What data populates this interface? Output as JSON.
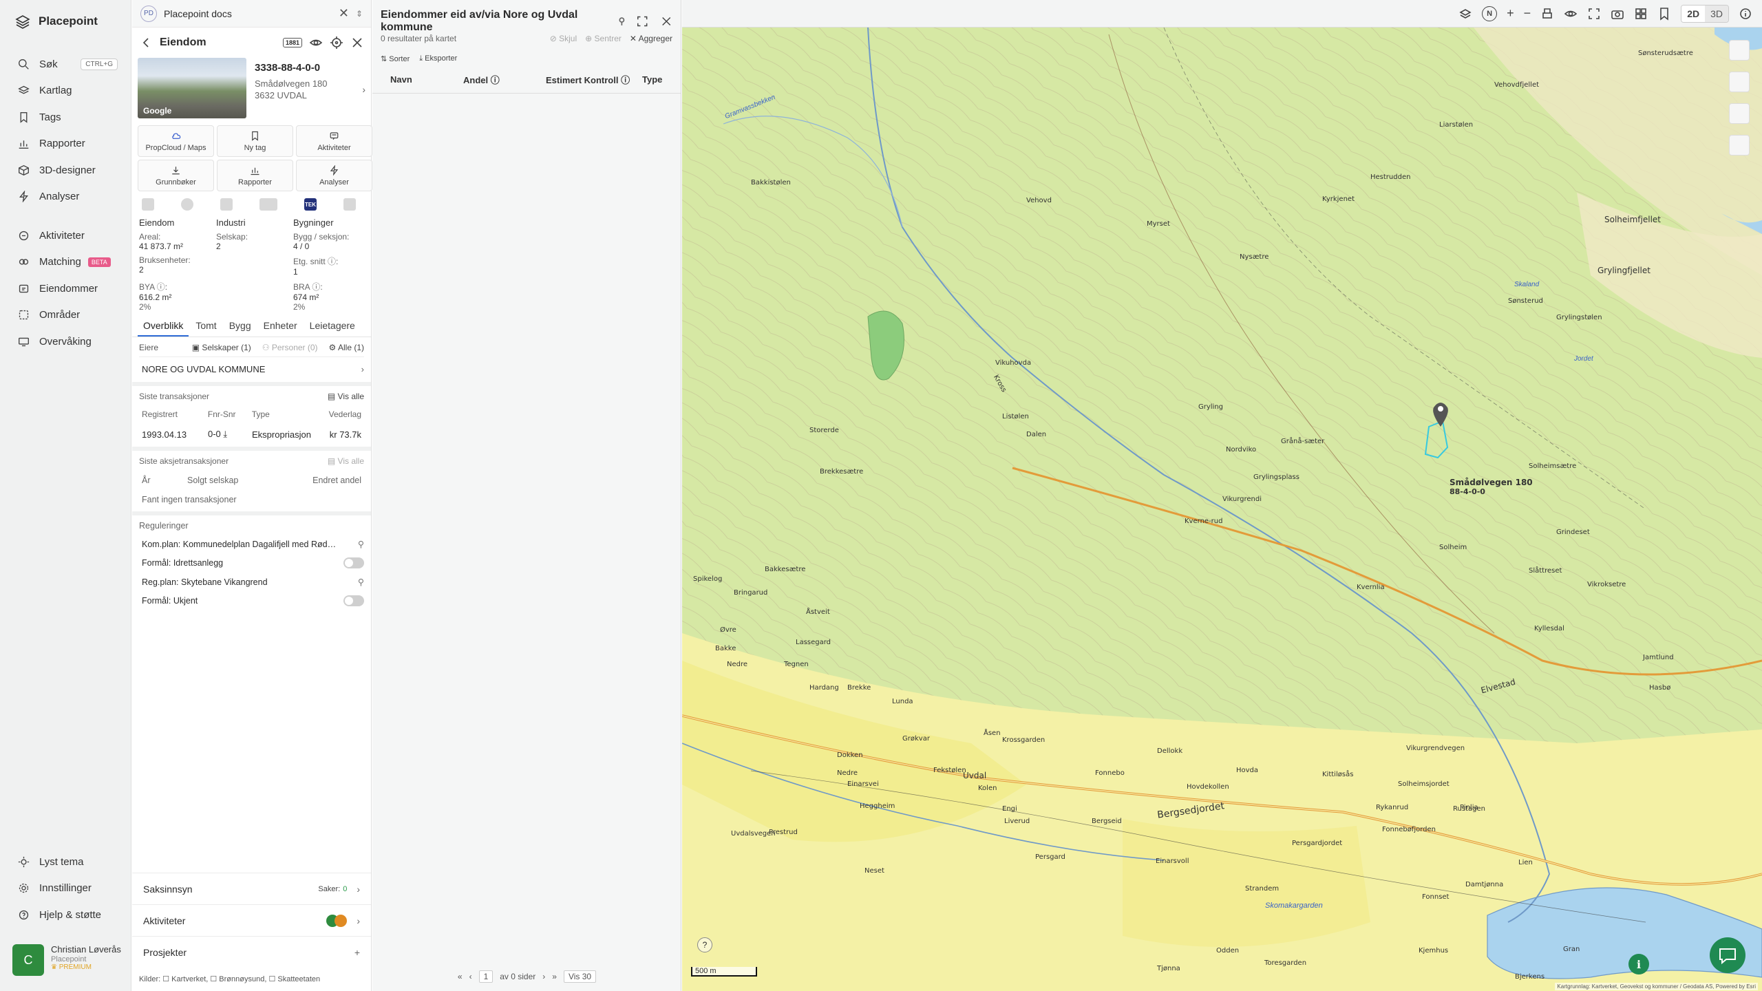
{
  "nav": {
    "brand": "Placepoint",
    "items": [
      {
        "label": "Søk",
        "icon": "search-icon",
        "shortcut": "CTRL+G"
      },
      {
        "label": "Kartlag",
        "icon": "layers-icon"
      },
      {
        "label": "Tags",
        "icon": "bookmark-icon"
      },
      {
        "label": "Rapporter",
        "icon": "chart-icon"
      },
      {
        "label": "3D-designer",
        "icon": "cube-icon"
      },
      {
        "label": "Analyser",
        "icon": "bolt-icon"
      }
    ],
    "items2": [
      {
        "label": "Aktiviteter",
        "icon": "activity-icon"
      },
      {
        "label": "Matching",
        "icon": "matching-icon",
        "badge": "BETA"
      },
      {
        "label": "Eiendommer",
        "icon": "property-icon"
      },
      {
        "label": "Områder",
        "icon": "area-icon"
      },
      {
        "label": "Overvåking",
        "icon": "monitor-icon"
      }
    ],
    "bottom": [
      {
        "label": "Lyst tema",
        "icon": "sun-icon"
      },
      {
        "label": "Innstillinger",
        "icon": "gear-icon"
      },
      {
        "label": "Hjelp & støtte",
        "icon": "help-icon"
      }
    ],
    "user": {
      "initial": "C",
      "name": "Christian Løverås",
      "org": "Placepoint",
      "plan": "PREMIUM"
    }
  },
  "docs": {
    "badge": "PD",
    "title": "Placepoint docs"
  },
  "property": {
    "header": "Eiendom",
    "id": "3338-88-4-0-0",
    "street": "Smådølvegen 180",
    "postal": "3632 UVDAL",
    "thumb_label": "Google",
    "actions": [
      {
        "label": "PropCloud / Maps",
        "icon": "cloud-icon"
      },
      {
        "label": "Ny tag",
        "icon": "bookmark-icon"
      },
      {
        "label": "Aktiviteter",
        "icon": "message-icon"
      },
      {
        "label": "Grunnbøker",
        "icon": "download-icon"
      },
      {
        "label": "Rapporter",
        "icon": "chart-icon"
      },
      {
        "label": "Analyser",
        "icon": "bolt-icon"
      }
    ],
    "tek_label": "TEK",
    "stats": {
      "c1": "Eiendom",
      "c2": "Industri",
      "c3": "Bygninger",
      "areal_l": "Areal:",
      "areal_v": "41 873.7 m²",
      "selskap_l": "Selskap:",
      "selskap_v": "2",
      "bygg_l": "Bygg / seksjon:",
      "bygg_v": "4 / 0",
      "bruks_l": "Bruksenheter:",
      "bruks_v": "2",
      "etg_l": "Etg. snitt ⓘ:",
      "etg_v": "1",
      "bya_l": "BYA ⓘ:",
      "bya_v": "616.2 m²",
      "bya_p": "2%",
      "bra_l": "BRA ⓘ:",
      "bra_v": "674 m²",
      "bra_p": "2%"
    },
    "tabs": [
      "Overblikk",
      "Tomt",
      "Bygg",
      "Enheter",
      "Leietagere"
    ],
    "owners": {
      "label": "Eiere",
      "f1": "Selskaper (1)",
      "f2": "Personer (0)",
      "f3": "Alle (1)",
      "name": "NORE OG UVDAL KOMMUNE"
    },
    "trans": {
      "title": "Siste transaksjoner",
      "viewall": "Vis alle",
      "headers": [
        "Registrert",
        "Fnr-Snr",
        "Type",
        "Vederlag"
      ],
      "row": [
        "1993.04.13",
        "0-0 ⤓",
        "Ekspropriasjon",
        "kr 73.7k"
      ]
    },
    "shares": {
      "title": "Siste aksjetransaksjoner",
      "viewall": "Vis alle",
      "headers": [
        "År",
        "Solgt selskap",
        "Endret andel"
      ],
      "empty": "Fant ingen transaksjoner"
    },
    "reg": {
      "title": "Reguleringer",
      "items": [
        {
          "text": "Kom.plan: Kommunedelplan Dagalifjell med Rød…",
          "link": true
        },
        {
          "text": "Formål: Idrettsanlegg",
          "toggle": true
        },
        {
          "text": "Reg.plan: Skytebane Vikangrend",
          "link": true
        },
        {
          "text": "Formål: Ukjent",
          "toggle": true
        }
      ]
    },
    "acc": {
      "s1": "Saksinnsyn",
      "s1_count_label": "Saker:",
      "s1_count": "0",
      "s2": "Aktiviteter",
      "s3": "Prosjekter"
    },
    "kilder": "Kilder: ☐ Kartverket, ☐ Brønnøysund, ☐ Skatteetaten"
  },
  "results": {
    "title": "Eiendommer eid av/via Nore og Uvdal kommune",
    "count": "0 resultater på kartet",
    "hide": "Skjul",
    "center": "Sentrer",
    "aggregate": "Aggreger",
    "sort": "Sorter",
    "export": "Eksporter",
    "cols": [
      "Navn",
      "Andel ⓘ",
      "Estimert Kontroll ⓘ",
      "Type"
    ],
    "pager": {
      "page": "1",
      "of": "av 0 sider",
      "show": "Vis 30"
    }
  },
  "topbar": {
    "mode2d": "2D",
    "mode3d": "3D",
    "compass": "N"
  },
  "map": {
    "scale": "500 m",
    "marker_label": "Smådølvegen 180",
    "marker_sub": "88-4-0-0",
    "attribution": "Kartgrunnlag: Kartverket, Geovekst og kommuner / Geodata AS, Powered by Esri",
    "places": [
      {
        "t": "Sønsterudsætre"
      },
      {
        "t": "Vehovdfjellet"
      },
      {
        "t": "Gramvassbekken",
        "water": true
      },
      {
        "t": "Bakkistølen"
      },
      {
        "t": "Vehovd"
      },
      {
        "t": "Myrset"
      },
      {
        "t": "Nysætre"
      },
      {
        "t": "Kyrkjenet"
      },
      {
        "t": "Hestrudden"
      },
      {
        "t": "Liarstølen"
      },
      {
        "t": "Solheimfjellet"
      },
      {
        "t": "Grylingfjellet"
      },
      {
        "t": "Vikuhovda"
      },
      {
        "t": "Listølen"
      },
      {
        "t": "Kross"
      },
      {
        "t": "Dalen"
      },
      {
        "t": "Grylingstølen"
      },
      {
        "t": "Gryling"
      },
      {
        "t": "Grånå-sæter"
      },
      {
        "t": "Sønsterud"
      },
      {
        "t": "Solheimsætre"
      },
      {
        "t": "Brekkesætre"
      },
      {
        "t": "Storerde"
      },
      {
        "t": "Bakkesætre"
      },
      {
        "t": "Nordviko"
      },
      {
        "t": "Grindeset"
      },
      {
        "t": "Kverne-rud"
      },
      {
        "t": "Vikurgrendi"
      },
      {
        "t": "Grylingsplass"
      },
      {
        "t": "Solheim"
      },
      {
        "t": "Slåttreset"
      },
      {
        "t": "Vikroksetre"
      },
      {
        "t": "Kvernlia"
      },
      {
        "t": "Bringarud"
      },
      {
        "t": "Åstveit"
      },
      {
        "t": "Øvre"
      },
      {
        "t": "Bakke"
      },
      {
        "t": "Nedre"
      },
      {
        "t": "Lassegard"
      },
      {
        "t": "Tegnen"
      },
      {
        "t": "Hardang"
      },
      {
        "t": "Brekke"
      },
      {
        "t": "Lunda"
      },
      {
        "t": "Dokken"
      },
      {
        "t": "Nedre"
      },
      {
        "t": "Einarsvei"
      },
      {
        "t": "Grøkvar"
      },
      {
        "t": "Åsen"
      },
      {
        "t": "Krossgarden"
      },
      {
        "t": "Uvdal"
      },
      {
        "t": "Fekstølen"
      },
      {
        "t": "Kolen"
      },
      {
        "t": "Fonnebo"
      },
      {
        "t": "Dellokk"
      },
      {
        "t": "Hovdekollen"
      },
      {
        "t": "Hovda"
      },
      {
        "t": "Kittiløsås"
      },
      {
        "t": "Solheimsjordet"
      },
      {
        "t": "Rustagen"
      },
      {
        "t": "Pinlia"
      },
      {
        "t": "Vikurgrendvegen"
      },
      {
        "t": "Kyllesdal"
      },
      {
        "t": "Hasbø"
      },
      {
        "t": "Jamtlund"
      },
      {
        "t": "Elvestad"
      },
      {
        "t": "Heggheim"
      },
      {
        "t": "Engi"
      },
      {
        "t": "Uvdalsvegen"
      },
      {
        "t": "Prestrud"
      },
      {
        "t": "Liverud"
      },
      {
        "t": "Persgard"
      },
      {
        "t": "Bergsedjordet"
      },
      {
        "t": "Bergseid"
      },
      {
        "t": "Einarsvoll"
      },
      {
        "t": "Persgardjordet"
      },
      {
        "t": "Fonnebøfjorden",
        "water": true
      },
      {
        "t": "Rykanrud"
      },
      {
        "t": "Neset"
      },
      {
        "t": "Strandem"
      },
      {
        "t": "Skomakargarden"
      },
      {
        "t": "Fonnset"
      },
      {
        "t": "Odden"
      },
      {
        "t": "Toresgarden"
      },
      {
        "t": "Tjønna",
        "water": true
      },
      {
        "t": "Damtjønna",
        "water": true
      },
      {
        "t": "Kjemhus"
      },
      {
        "t": "Bjerkens"
      },
      {
        "t": "Skaland"
      },
      {
        "t": "Jordet"
      },
      {
        "t": "Spikelog"
      },
      {
        "t": "Lien"
      },
      {
        "t": "Gran"
      }
    ]
  }
}
